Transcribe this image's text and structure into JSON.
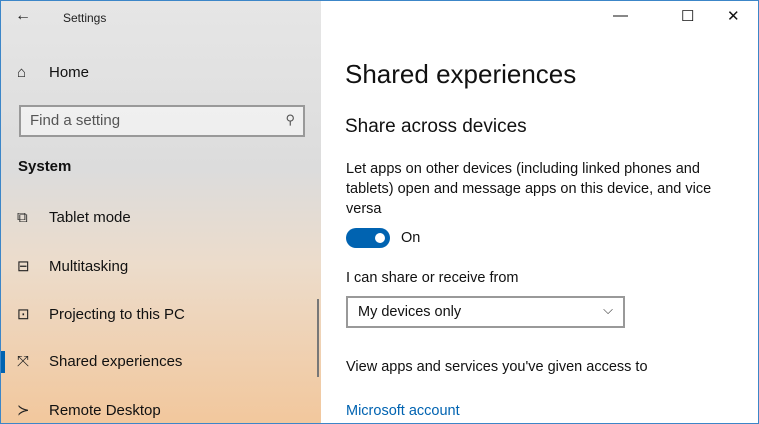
{
  "window": {
    "title": "Settings",
    "minimize": "—",
    "maximize": "☐",
    "close": "✕"
  },
  "sidebar": {
    "home": "Home",
    "search_placeholder": "Find a setting",
    "section": "System",
    "items": [
      {
        "label": "Tablet mode",
        "icon": "⧉"
      },
      {
        "label": "Multitasking",
        "icon": "⊟"
      },
      {
        "label": "Projecting to this PC",
        "icon": "⊡"
      },
      {
        "label": "Shared experiences",
        "icon": "⤧"
      },
      {
        "label": "Remote Desktop",
        "icon": "≻"
      }
    ],
    "selected": "Shared experiences"
  },
  "main": {
    "title": "Shared experiences",
    "section": "Share across devices",
    "description": "Let apps on other devices (including linked phones and tablets) open and message apps on this device, and vice versa",
    "toggle_state": "On",
    "share_label": "I can share or receive from",
    "share_value": "My devices only",
    "access_label": "View apps and services you've given access to",
    "link": "Microsoft account"
  },
  "colors": {
    "accent": "#0063b1"
  }
}
